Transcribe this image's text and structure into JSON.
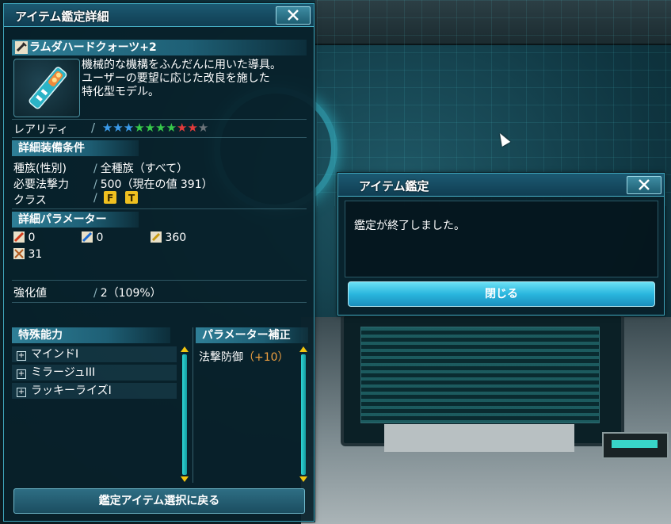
{
  "detail_window": {
    "title": "アイテム鑑定詳細",
    "item": {
      "name": "ラムダハードクォーツ+2",
      "description": [
        "機械的な機構をふんだんに用いた導具。",
        "ユーザーの要望に応じた改良を施した",
        "特化型モデル。"
      ]
    },
    "rarity": {
      "label": "レアリティ",
      "stars": 10,
      "star_colors": [
        "#3b9bea",
        "#3b9bea",
        "#3b9bea",
        "#38c94b",
        "#38c94b",
        "#38c94b",
        "#38c94b",
        "#e23b3b",
        "#e23b3b",
        "#6b7379"
      ]
    },
    "requirements": {
      "header": "詳細装備条件",
      "race_label": "種族(性別)",
      "race_value": "全種族（すべて）",
      "power_label": "必要法撃力",
      "power_value": "500（現在の値 391）",
      "class_label": "クラス",
      "class_icons": [
        "force-class-icon",
        "techter-class-icon"
      ]
    },
    "parameters": {
      "header": "詳細パラメーター",
      "strike_attack": "0",
      "ranged_attack": "0",
      "tech_attack": "360",
      "dexterity": "31"
    },
    "enhancement": {
      "label": "強化値",
      "value": "2（109%）"
    },
    "special_abilities": {
      "header": "特殊能力",
      "items": [
        "マインドI",
        "ミラージュIII",
        "ラッキーライズI"
      ]
    },
    "param_bonus": {
      "header": "パラメーター補正",
      "label": "法撃防御",
      "value": "（+10）"
    },
    "back_button": "鑑定アイテム選択に戻る"
  },
  "result_dialog": {
    "title": "アイテム鑑定",
    "message": "鑑定が終了しました。",
    "close_button": "閉じる"
  },
  "colors": {
    "accent": "#3fa7bd",
    "bonus_orange": "#f0a040",
    "button_cyan": "#35c4e8"
  }
}
